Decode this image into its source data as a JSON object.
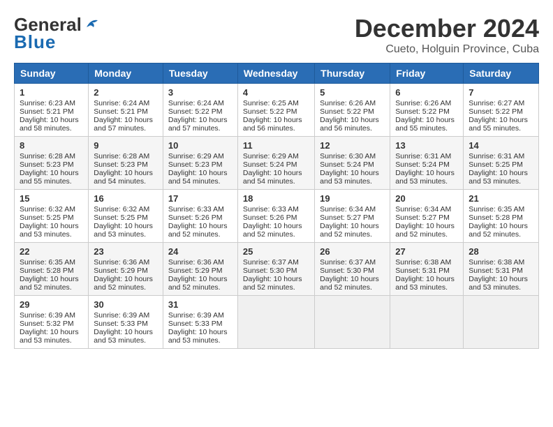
{
  "header": {
    "logo_general": "General",
    "logo_blue": "Blue",
    "main_title": "December 2024",
    "subtitle": "Cueto, Holguin Province, Cuba"
  },
  "calendar": {
    "days_of_week": [
      "Sunday",
      "Monday",
      "Tuesday",
      "Wednesday",
      "Thursday",
      "Friday",
      "Saturday"
    ],
    "weeks": [
      [
        {
          "day": "1",
          "data": "Sunrise: 6:23 AM\nSunset: 5:21 PM\nDaylight: 10 hours\nand 58 minutes."
        },
        {
          "day": "2",
          "data": "Sunrise: 6:24 AM\nSunset: 5:21 PM\nDaylight: 10 hours\nand 57 minutes."
        },
        {
          "day": "3",
          "data": "Sunrise: 6:24 AM\nSunset: 5:22 PM\nDaylight: 10 hours\nand 57 minutes."
        },
        {
          "day": "4",
          "data": "Sunrise: 6:25 AM\nSunset: 5:22 PM\nDaylight: 10 hours\nand 56 minutes."
        },
        {
          "day": "5",
          "data": "Sunrise: 6:26 AM\nSunset: 5:22 PM\nDaylight: 10 hours\nand 56 minutes."
        },
        {
          "day": "6",
          "data": "Sunrise: 6:26 AM\nSunset: 5:22 PM\nDaylight: 10 hours\nand 55 minutes."
        },
        {
          "day": "7",
          "data": "Sunrise: 6:27 AM\nSunset: 5:22 PM\nDaylight: 10 hours\nand 55 minutes."
        }
      ],
      [
        {
          "day": "8",
          "data": "Sunrise: 6:28 AM\nSunset: 5:23 PM\nDaylight: 10 hours\nand 55 minutes."
        },
        {
          "day": "9",
          "data": "Sunrise: 6:28 AM\nSunset: 5:23 PM\nDaylight: 10 hours\nand 54 minutes."
        },
        {
          "day": "10",
          "data": "Sunrise: 6:29 AM\nSunset: 5:23 PM\nDaylight: 10 hours\nand 54 minutes."
        },
        {
          "day": "11",
          "data": "Sunrise: 6:29 AM\nSunset: 5:24 PM\nDaylight: 10 hours\nand 54 minutes."
        },
        {
          "day": "12",
          "data": "Sunrise: 6:30 AM\nSunset: 5:24 PM\nDaylight: 10 hours\nand 53 minutes."
        },
        {
          "day": "13",
          "data": "Sunrise: 6:31 AM\nSunset: 5:24 PM\nDaylight: 10 hours\nand 53 minutes."
        },
        {
          "day": "14",
          "data": "Sunrise: 6:31 AM\nSunset: 5:25 PM\nDaylight: 10 hours\nand 53 minutes."
        }
      ],
      [
        {
          "day": "15",
          "data": "Sunrise: 6:32 AM\nSunset: 5:25 PM\nDaylight: 10 hours\nand 53 minutes."
        },
        {
          "day": "16",
          "data": "Sunrise: 6:32 AM\nSunset: 5:25 PM\nDaylight: 10 hours\nand 53 minutes."
        },
        {
          "day": "17",
          "data": "Sunrise: 6:33 AM\nSunset: 5:26 PM\nDaylight: 10 hours\nand 52 minutes."
        },
        {
          "day": "18",
          "data": "Sunrise: 6:33 AM\nSunset: 5:26 PM\nDaylight: 10 hours\nand 52 minutes."
        },
        {
          "day": "19",
          "data": "Sunrise: 6:34 AM\nSunset: 5:27 PM\nDaylight: 10 hours\nand 52 minutes."
        },
        {
          "day": "20",
          "data": "Sunrise: 6:34 AM\nSunset: 5:27 PM\nDaylight: 10 hours\nand 52 minutes."
        },
        {
          "day": "21",
          "data": "Sunrise: 6:35 AM\nSunset: 5:28 PM\nDaylight: 10 hours\nand 52 minutes."
        }
      ],
      [
        {
          "day": "22",
          "data": "Sunrise: 6:35 AM\nSunset: 5:28 PM\nDaylight: 10 hours\nand 52 minutes."
        },
        {
          "day": "23",
          "data": "Sunrise: 6:36 AM\nSunset: 5:29 PM\nDaylight: 10 hours\nand 52 minutes."
        },
        {
          "day": "24",
          "data": "Sunrise: 6:36 AM\nSunset: 5:29 PM\nDaylight: 10 hours\nand 52 minutes."
        },
        {
          "day": "25",
          "data": "Sunrise: 6:37 AM\nSunset: 5:30 PM\nDaylight: 10 hours\nand 52 minutes."
        },
        {
          "day": "26",
          "data": "Sunrise: 6:37 AM\nSunset: 5:30 PM\nDaylight: 10 hours\nand 52 minutes."
        },
        {
          "day": "27",
          "data": "Sunrise: 6:38 AM\nSunset: 5:31 PM\nDaylight: 10 hours\nand 53 minutes."
        },
        {
          "day": "28",
          "data": "Sunrise: 6:38 AM\nSunset: 5:31 PM\nDaylight: 10 hours\nand 53 minutes."
        }
      ],
      [
        {
          "day": "29",
          "data": "Sunrise: 6:39 AM\nSunset: 5:32 PM\nDaylight: 10 hours\nand 53 minutes."
        },
        {
          "day": "30",
          "data": "Sunrise: 6:39 AM\nSunset: 5:33 PM\nDaylight: 10 hours\nand 53 minutes."
        },
        {
          "day": "31",
          "data": "Sunrise: 6:39 AM\nSunset: 5:33 PM\nDaylight: 10 hours\nand 53 minutes."
        },
        {
          "day": "",
          "data": ""
        },
        {
          "day": "",
          "data": ""
        },
        {
          "day": "",
          "data": ""
        },
        {
          "day": "",
          "data": ""
        }
      ]
    ]
  }
}
